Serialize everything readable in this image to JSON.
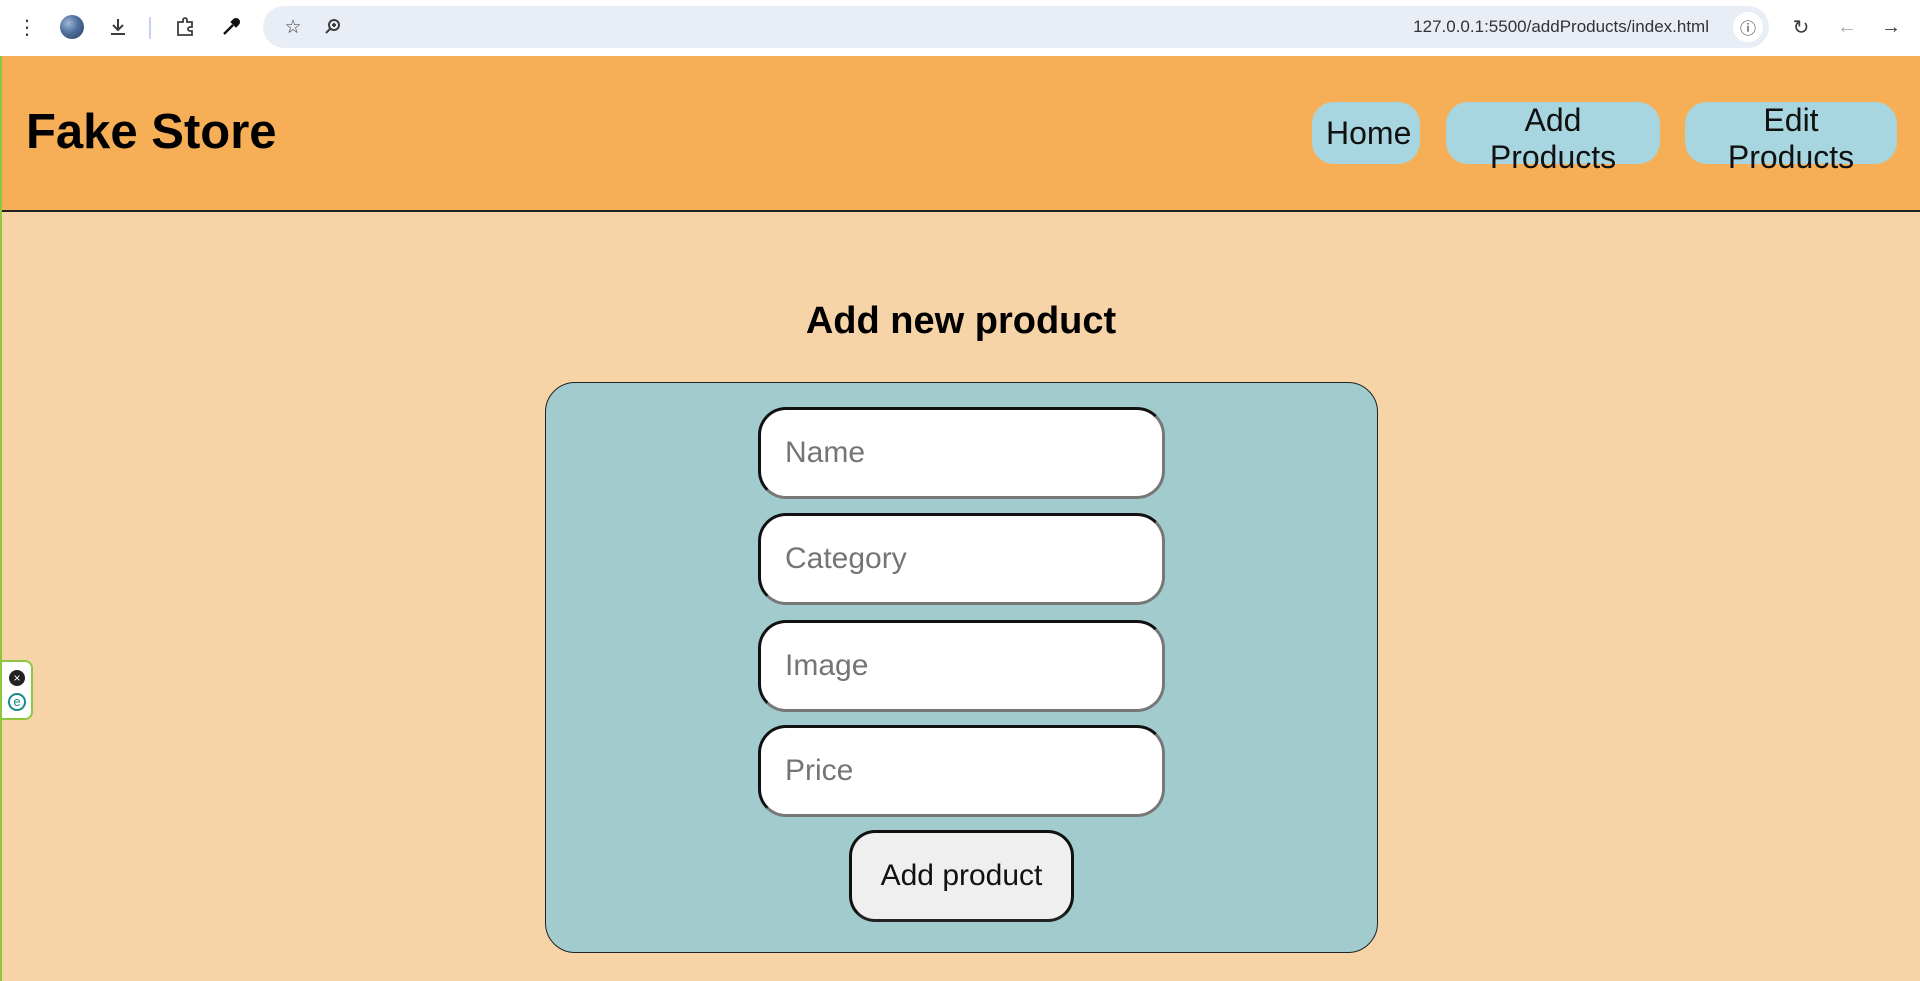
{
  "browser": {
    "url": "127.0.0.1:5500/addProducts/index.html"
  },
  "site": {
    "title": "Fake Store",
    "nav": {
      "home": "Home",
      "add_products": "Add Products",
      "edit_products": "Edit Products"
    },
    "colors": {
      "header": "#f7af57",
      "page_bg": "#f7d3a8",
      "card_bg": "#a1cbcd",
      "nav_button": "#a8d6e0"
    }
  },
  "form": {
    "heading": "Add new product",
    "name_placeholder": "Name",
    "category_placeholder": "Category",
    "image_placeholder": "Image",
    "price_placeholder": "Price",
    "submit_label": "Add product"
  },
  "icons": {
    "menu": "⋮",
    "download": "⤓",
    "extensions": "puzzle",
    "eyedropper": "eyedropper",
    "star": "☆",
    "zoom": "zoom",
    "info": "ⓘ",
    "reload": "↻",
    "back": "←",
    "forward": "→"
  }
}
